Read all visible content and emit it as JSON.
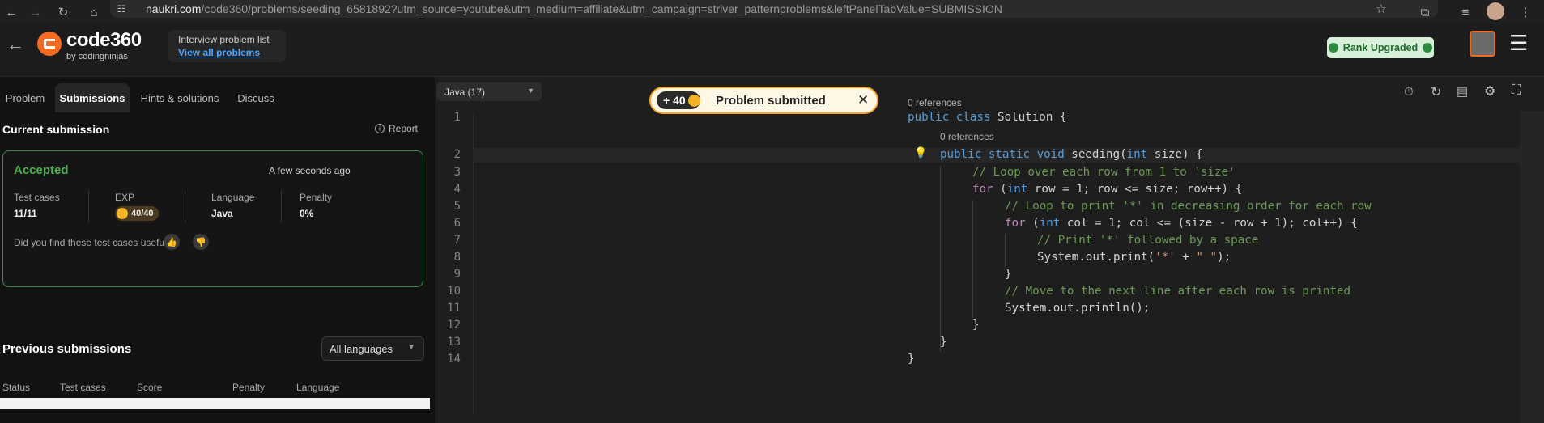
{
  "browser": {
    "url_host": "naukri.com",
    "url_path": "/code360/problems/seeding_6581892?utm_source=youtube&utm_medium=affiliate&utm_campaign=striver_patternproblems&leftPanelTabValue=SUBMISSION"
  },
  "header": {
    "logo_text": "code360",
    "logo_sub": "by codingninjas",
    "problem_list_title": "Interview problem list",
    "problem_list_link": "View all problems",
    "rank_button": "Rank Upgraded"
  },
  "tabs": [
    "Problem",
    "Submissions",
    "Hints & solutions",
    "Discuss"
  ],
  "current": {
    "title": "Current submission",
    "report": "Report",
    "status": "Accepted",
    "time": "A few seconds ago",
    "labels": [
      "Test cases",
      "EXP",
      "Language",
      "Penalty"
    ],
    "values": [
      "11/11",
      "40/40",
      "Java",
      "0%"
    ],
    "feedback_q": "Did you find these test cases useful?"
  },
  "previous": {
    "title": "Previous submissions",
    "filter": "All languages",
    "columns": [
      "Status",
      "Test cases",
      "Score",
      "Penalty",
      "Language"
    ]
  },
  "editor": {
    "language": "Java (17)",
    "toast_points": "+ 40",
    "toast_text": "Problem submitted",
    "ref_label": "0 references",
    "line_numbers": [
      "1",
      "2",
      "3",
      "4",
      "5",
      "6",
      "7",
      "8",
      "9",
      "10",
      "11",
      "12",
      "13",
      "14"
    ]
  },
  "colors": {
    "accepted": "#4caf50",
    "rank_button_bg": "#d8f0da",
    "toast_border": "#f5a623",
    "accent_orange": "#f26b21"
  }
}
